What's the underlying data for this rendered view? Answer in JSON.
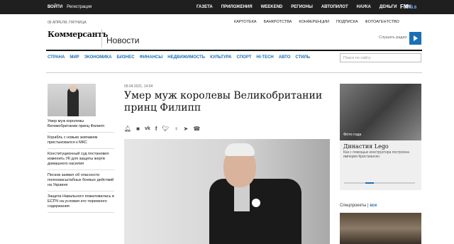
{
  "topbar": {
    "login": "ВОЙТИ",
    "register": "Регистрация",
    "links": [
      "ГАЗЕТА",
      "ПРИЛОЖЕНИЯ",
      "WEEKEND",
      "РЕГИОНЫ",
      "АВТОПИЛОТ",
      "НАУКА",
      "ДЕНЬГИ",
      "UK"
    ],
    "radio": "FM",
    "radio_freq": "93.6"
  },
  "header": {
    "date": "09 АПРЕЛЯ, ПЯТНИЦА",
    "links": [
      "КАРТОТЕКА",
      "БАНКРОТСТВА",
      "КОНФЕРЕНЦИИ",
      "ПОДПИСКА",
      "ФОТОАГЕНТСТВО"
    ],
    "logo": "Коммерсантъ",
    "section": "Новости",
    "subscribe": "Слушать радио"
  },
  "nav": {
    "items": [
      "СТРАНА",
      "МИР",
      "ЭКОНОМИКА",
      "БИЗНЕС",
      "ФИНАНСЫ",
      "НЕДВИЖИМОСТЬ",
      "КУЛЬТУРА",
      "СПОРТ",
      "HI-TECH",
      "АВТО",
      "СТИЛЬ"
    ],
    "search_placeholder": "Поиск по сайту"
  },
  "sidebar": {
    "items": [
      "Умер муж королевы Великобритании принц Филипп",
      "Корабль с новым экипажем пристыковался к МКС",
      "Конституционный суд постановил изменить УК для защиты жертв домашнего насилия",
      "Песков заявил об опасности полномасштабных боевых действий на Украине",
      "Защита Навального пожаловалась в ЕСПЧ на условия его тюремного содержания"
    ]
  },
  "article": {
    "date": "09.04.2021, 14:04",
    "headline": "Умер муж королевы Великобритании принц Филипп"
  },
  "share_icons": [
    "bell-icon",
    "comment-icon",
    "vk-icon",
    "facebook-icon",
    "twitter-icon",
    "ok-icon",
    "telegram-icon",
    "whatsapp-icon"
  ],
  "promo": {
    "caption": "Фото года",
    "title": "Династия Lego",
    "text": "Как с помощью конструктора построена империя Кристиансен"
  },
  "specprojects": {
    "label": "Спецпроекты",
    "all": "все"
  },
  "colors": {
    "accent": "#1b6fb5",
    "topbar": "#1f1f1f"
  }
}
